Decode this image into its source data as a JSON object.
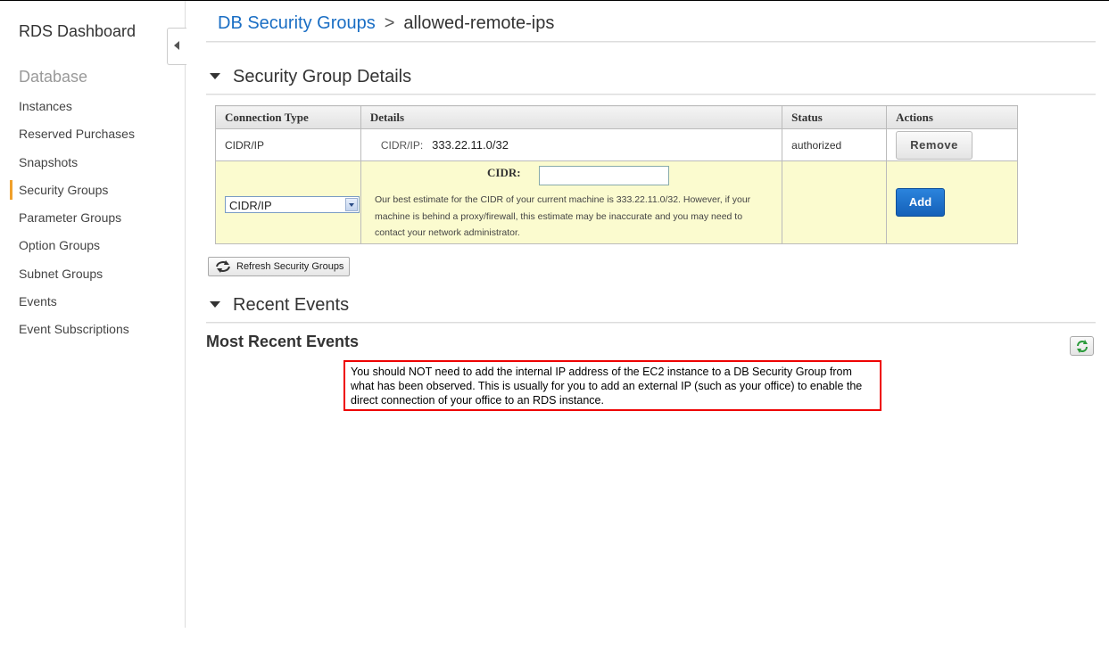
{
  "sidebar": {
    "title": "RDS Dashboard",
    "section": "Database",
    "items": [
      {
        "label": "Instances"
      },
      {
        "label": "Reserved Purchases"
      },
      {
        "label": "Snapshots"
      },
      {
        "label": "Security Groups",
        "active": true
      },
      {
        "label": "Parameter Groups"
      },
      {
        "label": "Option Groups"
      },
      {
        "label": "Subnet Groups"
      },
      {
        "label": "Events"
      },
      {
        "label": "Event Subscriptions"
      }
    ]
  },
  "breadcrumb": {
    "parent": "DB Security Groups",
    "separator": ">",
    "current": "allowed-remote-ips"
  },
  "details": {
    "heading": "Security Group Details",
    "columns": [
      "Connection Type",
      "Details",
      "Status",
      "Actions"
    ],
    "row": {
      "type": "CIDR/IP",
      "cidr_label": "CIDR/IP:",
      "cidr_value": "333.22.11.0/32",
      "status": "authorized",
      "action": "Remove"
    },
    "new_rule": {
      "type_selected": "CIDR/IP",
      "cidr_label": "CIDR:",
      "cidr_value": "",
      "estimate": "Our best estimate for the CIDR of your current machine is 333.22.11.0/32. However, if your machine is behind a proxy/firewall, this estimate may be inaccurate and you may need to contact your network administrator.",
      "action": "Add"
    },
    "refresh_label": "Refresh Security Groups"
  },
  "events": {
    "heading": "Recent Events",
    "subheading": "Most Recent Events",
    "note": "You should NOT need to add the internal IP address of the EC2 instance to a DB Security Group from what has been observed.  This is usually for you to add an external IP (such as your office) to enable the direct connection of your office to an RDS instance."
  },
  "colors": {
    "link": "#1a6ec4",
    "active_marker": "#f0a02b",
    "add_button": "#1460b8",
    "new_row_bg": "#fbfbcf",
    "note_border": "#ee0000"
  }
}
